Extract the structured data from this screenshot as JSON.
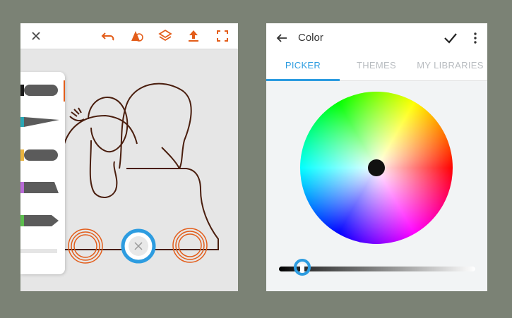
{
  "colors": {
    "accent_orange": "#e35d1a",
    "accent_blue": "#2d9ce0",
    "background": "#7b8275",
    "canvas": "#e6e6e6"
  },
  "left_toolbar": {
    "icons": [
      "close-icon",
      "undo-icon",
      "shape-icon",
      "layers-icon",
      "upload-icon",
      "fullscreen-icon"
    ]
  },
  "brush_drawer": {
    "swatch_colors": [
      "#1a1a1a",
      "#2aa7b5",
      "#e8b440",
      "#b86ad6",
      "#5bbd4d",
      "#dddddd"
    ]
  },
  "color_panel": {
    "title": "Color",
    "tabs": [
      {
        "label": "PICKER",
        "active": true
      },
      {
        "label": "THEMES",
        "active": false
      },
      {
        "label": "MY LIBRARIES",
        "active": false
      }
    ],
    "icons": [
      "back-arrow-icon",
      "checkmark-icon",
      "more-vert-icon"
    ],
    "brightness_level": 0.05
  }
}
